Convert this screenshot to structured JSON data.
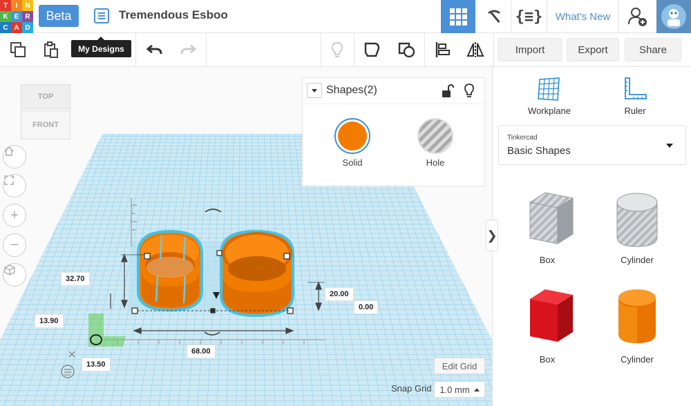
{
  "logo": {
    "letters": [
      "T",
      "I",
      "N",
      "K",
      "E",
      "R",
      "C",
      "A",
      "D"
    ],
    "colors": [
      "#e2382b",
      "#f18621",
      "#f4bf1e",
      "#4fb848",
      "#3d9ad8",
      "#8a4d9e",
      "#1d7cc4",
      "#e2382b",
      "#28a9e0"
    ]
  },
  "header": {
    "beta_label": "Beta",
    "design_title": "Tremendous Esboo",
    "whats_new": "What's New"
  },
  "tooltip": {
    "text": "My Designs"
  },
  "toolbar": {
    "import_label": "Import",
    "export_label": "Export",
    "share_label": "Share"
  },
  "viewcube": {
    "top": "TOP",
    "front": "FRONT"
  },
  "inspector": {
    "title": "Shapes(2)",
    "solid_label": "Solid",
    "hole_label": "Hole",
    "solid_color": "#f27c00"
  },
  "dimensions": {
    "height": "32.70",
    "y_offset": "13.90",
    "x_offset": "13.50",
    "width": "68.00",
    "z_height": "20.00",
    "elevation": "0.00"
  },
  "grid": {
    "edit_label": "Edit Grid",
    "snap_label": "Snap Grid",
    "snap_value": "1.0 mm"
  },
  "right_panel": {
    "workplane_label": "Workplane",
    "ruler_label": "Ruler",
    "library_source": "Tinkercad",
    "library_name": "Basic Shapes",
    "shapes": [
      {
        "label": "Box"
      },
      {
        "label": "Cylinder"
      },
      {
        "label": "Box"
      },
      {
        "label": "Cylinder"
      }
    ]
  },
  "colors": {
    "accent": "#4a90d9",
    "orange": "#f27c00",
    "red": "#d8141e",
    "grid": "#9fd4ea"
  }
}
